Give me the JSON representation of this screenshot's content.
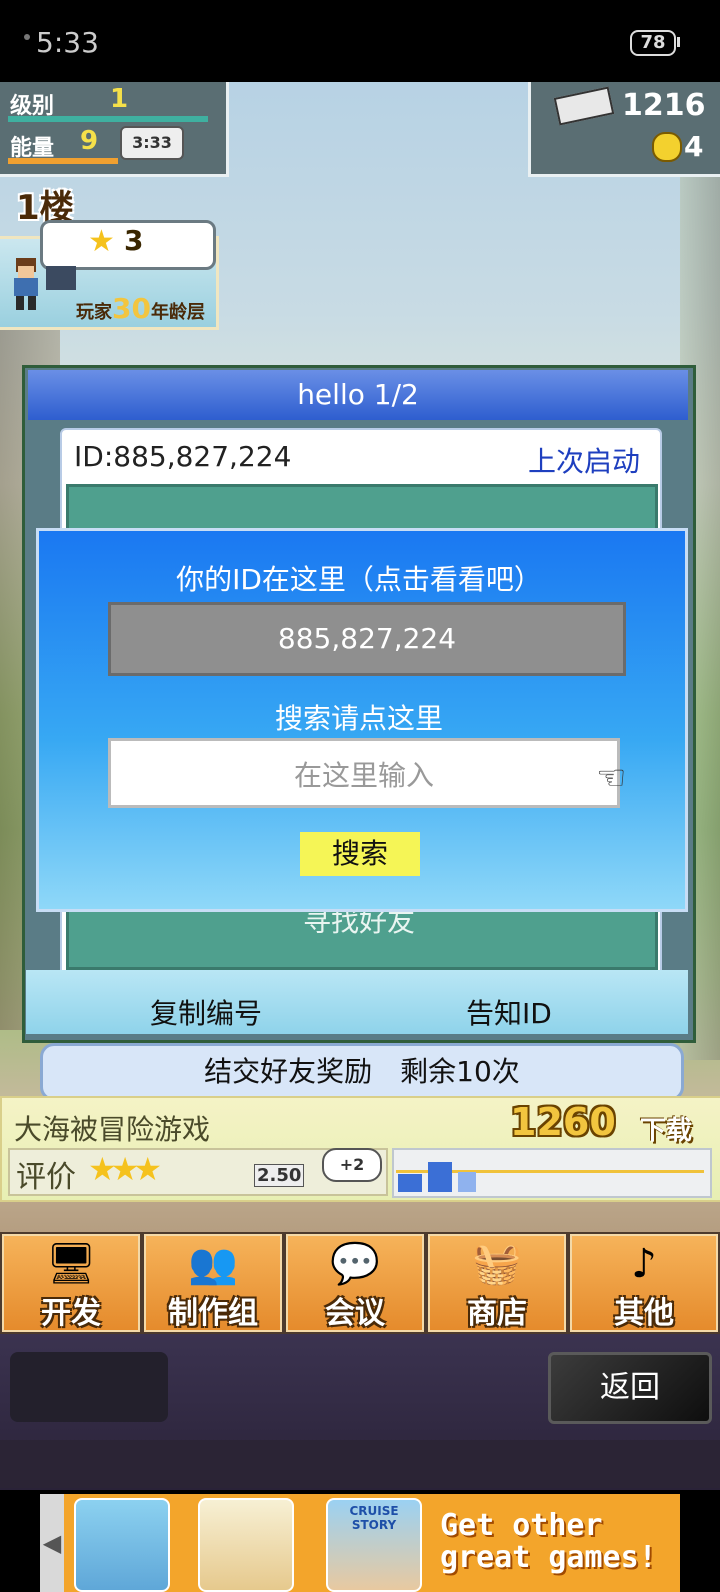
{
  "status_bar": {
    "time": "5:33",
    "battery": "78"
  },
  "hud": {
    "level_label": "级别",
    "level_value": "1",
    "energy_label": "能量",
    "energy_value": "9",
    "energy_timer": "3:33",
    "money": "1216",
    "coins": "4"
  },
  "floor": {
    "label": "1楼"
  },
  "player": {
    "stars": "3",
    "age_prefix": "玩家",
    "age_value": "30",
    "age_suffix": "年龄层"
  },
  "panel": {
    "title": "hello 1/2",
    "id_text": "ID:885,827,224",
    "last_launch": "上次启动",
    "find_friends": "寻找好友",
    "copy_id": "复制编号",
    "tell_id": "告知ID"
  },
  "reward": {
    "text": "结交好友奖励　剩余10次"
  },
  "dialog": {
    "title": "你的ID在这里（点击看看吧）",
    "id_value": "885,827,224",
    "search_label": "搜索请点这里",
    "search_placeholder": "在这里输入",
    "search_button": "搜索"
  },
  "game_info": {
    "name": "大海被冒险游戏",
    "sales": "1260",
    "sales_label": "下载",
    "rating_label": "评价",
    "rating_score": "2.50",
    "plus_badge": "+2"
  },
  "menu": {
    "items": [
      {
        "label": "开发",
        "icon": "monitor-icon"
      },
      {
        "label": "制作组",
        "icon": "team-icon"
      },
      {
        "label": "会议",
        "icon": "chat-icon"
      },
      {
        "label": "商店",
        "icon": "shop-icon"
      },
      {
        "label": "其他",
        "icon": "music-icon"
      }
    ]
  },
  "bottom": {
    "back_label": "返回"
  },
  "ad": {
    "thumb3_label": "CRUISE STORY",
    "text_line1": "Get other",
    "text_line2": "great games!"
  },
  "colors": {
    "dialog_blue": "#1a78f2",
    "search_yellow": "#f5f556",
    "link_blue": "#1e3fbf"
  }
}
